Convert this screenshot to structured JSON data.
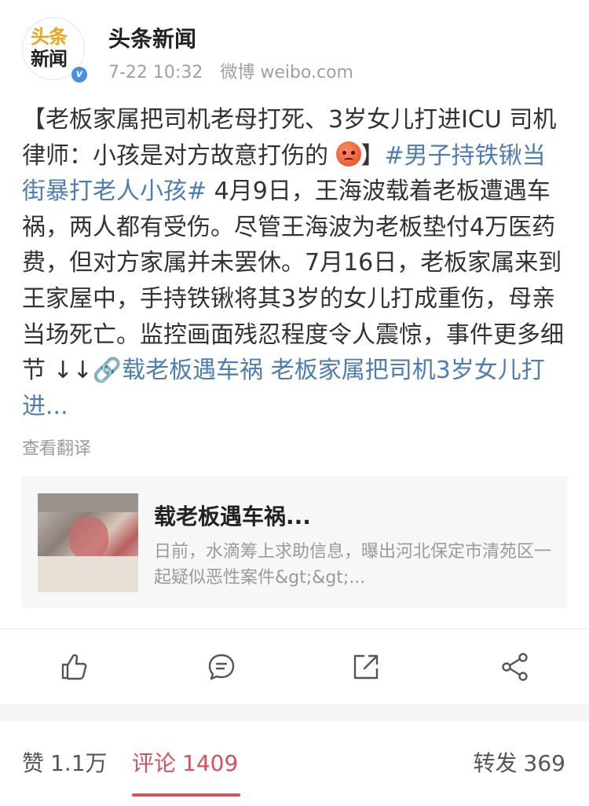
{
  "author": {
    "name": "头条新闻",
    "logo_line1": "头条",
    "logo_line2": "新闻",
    "verified_mark": "v",
    "time": "7-22 10:32",
    "source": "微博 weibo.com"
  },
  "post": {
    "part1": "【老板家属把司机老母打死、3岁女儿打进ICU 司机律师：小孩是对方故意打伤的 ",
    "part2": "】",
    "hashtag": "#男子持铁锹当街暴打老人小孩#",
    "body": " 4月9日，王海波载着老板遭遇车祸，两人都有受伤。尽管王海波为老板垫付4万医药费，但对方家属并未罢休。7月16日，老板家属来到王家屋中，手持铁锹将其3岁的女儿打成重伤，母亲当场死亡。监控画面残忍程度令人震惊，事件更多细节 ↓↓",
    "link_icon": "🔗",
    "link_text": "载老板遇车祸 老板家属把司机3岁女儿打进...",
    "emoji": "angry-face-icon"
  },
  "translate_label": "查看翻译",
  "article": {
    "title": "载老板遇车祸...",
    "description": "日前，水滴筹上求助信息，曝出河北保定市清苑区一起疑似恶性案件&gt;&gt;..."
  },
  "actions": [
    "like-icon",
    "comment-icon",
    "share-icon",
    "more-share-icon"
  ],
  "stats": {
    "likes_label": "赞",
    "likes_count": "1.1万",
    "comments_label": "评论",
    "comments_count": "1409",
    "reposts_label": "转发",
    "reposts_count": "369"
  },
  "colors": {
    "hashtag": "#4f7db2",
    "active_tab": "#d3525c",
    "verified": "#4a90e2",
    "logo_accent": "#e8a61a"
  }
}
